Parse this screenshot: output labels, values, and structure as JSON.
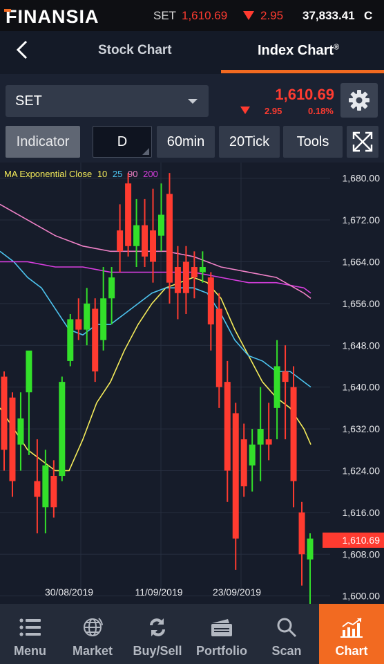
{
  "topbar": {
    "brand": "FINANSIA",
    "ticker_name": "SET",
    "ticker_last": "1,610.69",
    "ticker_change": "2.95",
    "ticker_volume": "37,833.41",
    "ticker_letter": "C"
  },
  "header": {
    "tab_stock": "Stock Chart",
    "tab_index": "Index Chart",
    "tab_index_mark": "®"
  },
  "symbol": {
    "selected": "SET",
    "price": "1,610.69",
    "change": "2.95",
    "change_pct": "0.18%"
  },
  "toolbar": {
    "indicator": "Indicator",
    "period_d": "D",
    "period_60": "60min",
    "period_tick": "20Tick",
    "tools": "Tools"
  },
  "legend": {
    "label": "MA Exponential Close",
    "p10": "10",
    "p25": "25",
    "p90": "90",
    "p200": "200"
  },
  "nav": {
    "menu": "Menu",
    "market": "Market",
    "buysell": "Buy/Sell",
    "portfolio": "Portfolio",
    "scan": "Scan",
    "chart": "Chart"
  },
  "colors": {
    "accent": "#f26a21",
    "down": "#ff3b30",
    "up": "#33e02a",
    "ma10": "#f5ec5a",
    "ma25": "#4dc4ef",
    "ma90": "#d83ee0",
    "ma200": "#f082c8"
  },
  "chart_data": {
    "type": "candlestick",
    "y_ticks": [
      "1,680.00",
      "1,672.00",
      "1,664.00",
      "1,656.00",
      "1,648.00",
      "1,640.00",
      "1,632.00",
      "1,624.00",
      "1,616.00",
      "1,608.00",
      "1,600.00"
    ],
    "ylim": [
      1598.5,
      1683
    ],
    "x_tick_labels": [
      "30/08/2019",
      "11/09/2019",
      "23/09/2019"
    ],
    "last_price_label": "1,610.69",
    "last_price": 1610.69,
    "candles": [
      {
        "o": 1642,
        "c": 1628,
        "h": 1643,
        "l": 1624
      },
      {
        "o": 1638,
        "c": 1622,
        "h": 1639,
        "l": 1619
      },
      {
        "o": 1629,
        "c": 1634,
        "h": 1639,
        "l": 1624
      },
      {
        "o": 1639,
        "c": 1647,
        "h": 1646,
        "l": 1627
      },
      {
        "o": 1622,
        "c": 1619,
        "h": 1630,
        "l": 1612
      },
      {
        "o": 1617,
        "c": 1625,
        "h": 1628,
        "l": 1612
      },
      {
        "o": 1623,
        "c": 1617,
        "h": 1626,
        "l": 1615
      },
      {
        "o": 1623,
        "c": 1641,
        "h": 1642,
        "l": 1622
      },
      {
        "o": 1645,
        "c": 1653,
        "h": 1654,
        "l": 1644
      },
      {
        "o": 1653,
        "c": 1651,
        "h": 1657,
        "l": 1649
      },
      {
        "o": 1651,
        "c": 1656,
        "h": 1659,
        "l": 1648
      },
      {
        "o": 1655,
        "c": 1643,
        "h": 1657,
        "l": 1641
      },
      {
        "o": 1649,
        "c": 1657,
        "h": 1663,
        "l": 1647
      },
      {
        "o": 1657,
        "c": 1661,
        "h": 1663,
        "l": 1652
      },
      {
        "o": 1670,
        "c": 1666,
        "h": 1675,
        "l": 1662
      },
      {
        "o": 1679,
        "c": 1667,
        "h": 1681,
        "l": 1665
      },
      {
        "o": 1667,
        "c": 1671,
        "h": 1676,
        "l": 1663
      },
      {
        "o": 1671,
        "c": 1665,
        "h": 1676,
        "l": 1663
      },
      {
        "o": 1670,
        "c": 1664,
        "h": 1678,
        "l": 1660
      },
      {
        "o": 1669,
        "c": 1673,
        "h": 1679,
        "l": 1666
      },
      {
        "o": 1677,
        "c": 1660,
        "h": 1681,
        "l": 1656
      },
      {
        "o": 1663,
        "c": 1658,
        "h": 1667,
        "l": 1653
      },
      {
        "o": 1664,
        "c": 1658,
        "h": 1667,
        "l": 1654
      },
      {
        "o": 1663,
        "c": 1661,
        "h": 1666,
        "l": 1657
      },
      {
        "o": 1662,
        "c": 1663,
        "h": 1666,
        "l": 1660
      },
      {
        "o": 1661,
        "c": 1652,
        "h": 1662,
        "l": 1647
      },
      {
        "o": 1655,
        "c": 1640,
        "h": 1658,
        "l": 1636
      },
      {
        "o": 1641,
        "c": 1624,
        "h": 1645,
        "l": 1618
      },
      {
        "o": 1635,
        "c": 1611,
        "h": 1637,
        "l": 1605
      },
      {
        "o": 1630,
        "c": 1621,
        "h": 1633,
        "l": 1619
      },
      {
        "o": 1625,
        "c": 1629,
        "h": 1632,
        "l": 1620
      },
      {
        "o": 1629,
        "c": 1632,
        "h": 1640,
        "l": 1622
      },
      {
        "o": 1630,
        "c": 1629,
        "h": 1637,
        "l": 1626
      },
      {
        "o": 1636,
        "c": 1644,
        "h": 1649,
        "l": 1630
      },
      {
        "o": 1643,
        "c": 1641,
        "h": 1648,
        "l": 1630
      },
      {
        "o": 1640,
        "c": 1622,
        "h": 1644,
        "l": 1617
      },
      {
        "o": 1616,
        "c": 1608,
        "h": 1618,
        "l": 1602
      },
      {
        "o": 1607,
        "c": 1611,
        "h": 1612,
        "l": 1598
      }
    ],
    "series": [
      {
        "name": "10",
        "points": [
          [
            0,
            1636
          ],
          [
            20,
            1632
          ],
          [
            40,
            1628
          ],
          [
            60,
            1626
          ],
          [
            80,
            1624
          ],
          [
            100,
            1624
          ],
          [
            120,
            1630
          ],
          [
            140,
            1637
          ],
          [
            160,
            1641
          ],
          [
            180,
            1647
          ],
          [
            200,
            1652
          ],
          [
            220,
            1656
          ],
          [
            240,
            1659
          ],
          [
            260,
            1660
          ],
          [
            280,
            1661
          ],
          [
            300,
            1660
          ],
          [
            320,
            1657
          ],
          [
            340,
            1651
          ],
          [
            360,
            1646
          ],
          [
            380,
            1641
          ],
          [
            400,
            1638
          ],
          [
            420,
            1636
          ],
          [
            440,
            1632
          ],
          [
            450,
            1629
          ]
        ]
      },
      {
        "name": "25",
        "points": [
          [
            0,
            1666
          ],
          [
            20,
            1664
          ],
          [
            40,
            1661
          ],
          [
            60,
            1659
          ],
          [
            80,
            1655
          ],
          [
            100,
            1651
          ],
          [
            120,
            1650
          ],
          [
            140,
            1652
          ],
          [
            160,
            1652
          ],
          [
            180,
            1654
          ],
          [
            200,
            1656
          ],
          [
            220,
            1658
          ],
          [
            240,
            1659
          ],
          [
            260,
            1659
          ],
          [
            280,
            1659
          ],
          [
            300,
            1658
          ],
          [
            320,
            1654
          ],
          [
            340,
            1649
          ],
          [
            360,
            1646
          ],
          [
            380,
            1645
          ],
          [
            400,
            1643
          ],
          [
            420,
            1643
          ],
          [
            440,
            1641
          ],
          [
            450,
            1640
          ]
        ]
      },
      {
        "name": "90",
        "points": [
          [
            0,
            1664
          ],
          [
            40,
            1664
          ],
          [
            80,
            1663
          ],
          [
            120,
            1663
          ],
          [
            160,
            1662
          ],
          [
            200,
            1662
          ],
          [
            240,
            1662
          ],
          [
            280,
            1662
          ],
          [
            320,
            1661
          ],
          [
            360,
            1660
          ],
          [
            400,
            1660
          ],
          [
            440,
            1659
          ],
          [
            450,
            1658
          ]
        ]
      },
      {
        "name": "200",
        "points": [
          [
            0,
            1675
          ],
          [
            40,
            1672
          ],
          [
            80,
            1669
          ],
          [
            120,
            1667
          ],
          [
            160,
            1666
          ],
          [
            200,
            1666
          ],
          [
            240,
            1666
          ],
          [
            280,
            1665
          ],
          [
            320,
            1663
          ],
          [
            360,
            1662
          ],
          [
            400,
            1661
          ],
          [
            440,
            1658
          ],
          [
            450,
            1657
          ]
        ]
      }
    ]
  }
}
